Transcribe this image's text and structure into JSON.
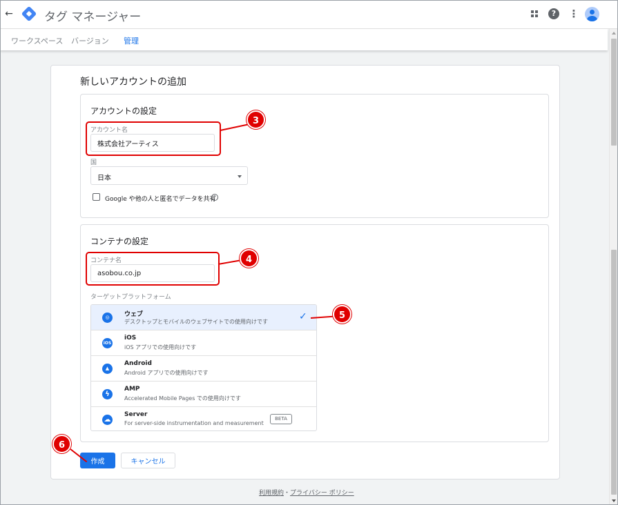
{
  "app": {
    "title": "タグ マネージャー",
    "back_icon": "←",
    "more_icon": "⋮",
    "help_icon": "?"
  },
  "tabs": [
    {
      "label": "ワークスペース",
      "active": false
    },
    {
      "label": "バージョン",
      "active": false
    },
    {
      "label": "管理",
      "active": true
    }
  ],
  "page": {
    "title": "新しいアカウントの追加"
  },
  "account_section": {
    "title": "アカウントの設定",
    "name_label": "アカウント名",
    "name_value": "株式会社アーティス",
    "country_label": "国",
    "country_value": "日本",
    "share_label": "Google や他の人と匿名でデータを共有",
    "share_checked": false
  },
  "container_section": {
    "title": "コンテナの設定",
    "name_label": "コンテナ名",
    "name_value": "asobou.co.jp",
    "platform_label": "ターゲットプラットフォーム",
    "platforms": [
      {
        "name": "ウェブ",
        "desc": "デスクトップとモバイルのウェブサイトでの使用向けです",
        "icon": "globe-icon",
        "glyph": "◎",
        "selected": true
      },
      {
        "name": "iOS",
        "desc": "iOS アプリでの使用向けです",
        "icon": "ios-icon",
        "glyph": "iOS",
        "selected": false
      },
      {
        "name": "Android",
        "desc": "Android アプリでの使用向けです",
        "icon": "android-icon",
        "glyph": "▲",
        "selected": false
      },
      {
        "name": "AMP",
        "desc": "Accelerated Mobile Pages での使用向けです",
        "icon": "amp-icon",
        "glyph": "ϟ",
        "selected": false
      },
      {
        "name": "Server",
        "desc": "For server-side instrumentation and measurement",
        "icon": "cloud-icon",
        "glyph": "☁",
        "selected": false,
        "badge": "BETA"
      }
    ],
    "check_glyph": "✓"
  },
  "actions": {
    "create_label": "作成",
    "cancel_label": "キャンセル"
  },
  "footer": {
    "terms": "利用規約",
    "separator": "・",
    "privacy": "プライバシー ポリシー"
  },
  "annotations": {
    "badge_3": "3",
    "badge_4": "4",
    "badge_5": "5",
    "badge_6": "6",
    "color": "#e00000"
  },
  "colors": {
    "accent": "#1a73e8",
    "selected_row": "#e8f0fe",
    "annotation": "#e00000"
  }
}
